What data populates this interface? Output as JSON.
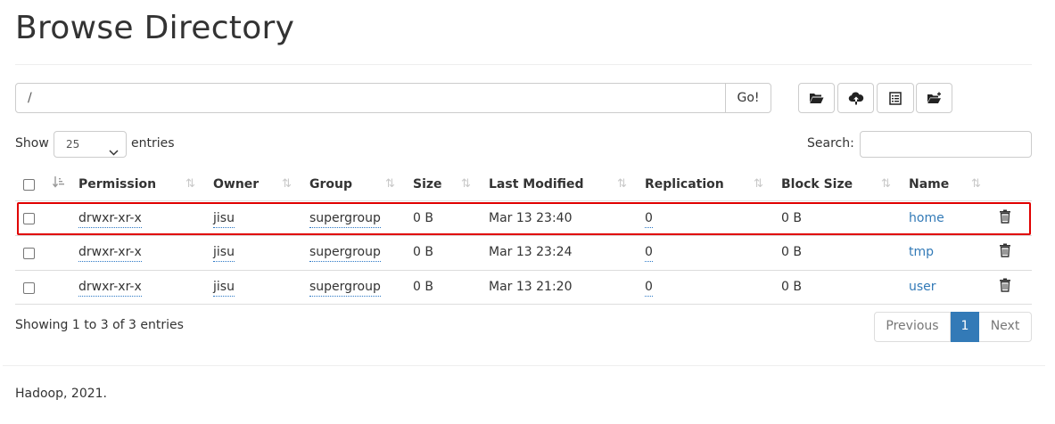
{
  "page": {
    "title": "Browse Directory",
    "footer": "Hadoop, 2021."
  },
  "path": {
    "value": "/",
    "go_label": "Go!"
  },
  "toolbar": {
    "icons": [
      "folder-open-icon",
      "cloud-upload-icon",
      "list-alt-icon",
      "new-folder-icon"
    ]
  },
  "length": {
    "show_label": "Show",
    "selected": "25",
    "entries_label": "entries"
  },
  "search": {
    "label": "Search:",
    "value": ""
  },
  "table": {
    "headers": [
      "Permission",
      "Owner",
      "Group",
      "Size",
      "Last Modified",
      "Replication",
      "Block Size",
      "Name"
    ],
    "rows": [
      {
        "permission": "drwxr-xr-x",
        "owner": "jisu",
        "group": "supergroup",
        "size": "0 B",
        "modified": "Mar 13 23:40",
        "replication": "0",
        "block_size": "0 B",
        "name": "home",
        "highlighted": true
      },
      {
        "permission": "drwxr-xr-x",
        "owner": "jisu",
        "group": "supergroup",
        "size": "0 B",
        "modified": "Mar 13 23:24",
        "replication": "0",
        "block_size": "0 B",
        "name": "tmp",
        "highlighted": false
      },
      {
        "permission": "drwxr-xr-x",
        "owner": "jisu",
        "group": "supergroup",
        "size": "0 B",
        "modified": "Mar 13 21:20",
        "replication": "0",
        "block_size": "0 B",
        "name": "user",
        "highlighted": false
      }
    ]
  },
  "info": "Showing 1 to 3 of 3 entries",
  "pagination": {
    "previous": "Previous",
    "current": "1",
    "next": "Next"
  },
  "colors": {
    "link": "#337ab7",
    "active_page": "#337ab7",
    "highlight_border": "#e00000"
  }
}
